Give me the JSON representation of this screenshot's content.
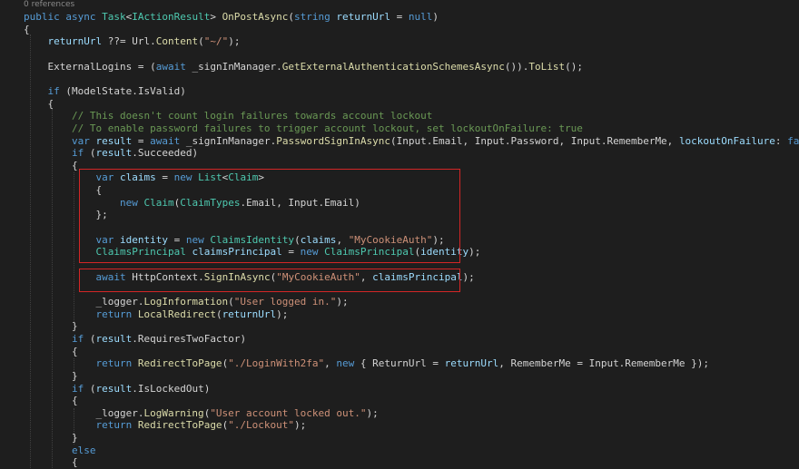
{
  "editor": {
    "codelens": "0 references",
    "colors": {
      "background": "#1e1e1e",
      "keyword": "#569cd6",
      "type": "#4ec9b0",
      "method": "#dcdcaa",
      "variable": "#9cdcfe",
      "string": "#ce9178",
      "comment": "#6a9955",
      "text": "#d4d4d4",
      "highlight_box": "#d32626"
    },
    "lines": [
      [
        [
          "public async ",
          "kw"
        ],
        [
          "Task",
          "ty"
        ],
        [
          "<",
          "pl"
        ],
        [
          "IActionResult",
          "ty"
        ],
        [
          "> ",
          "pl"
        ],
        [
          "OnPostAsync",
          "fn"
        ],
        [
          "(",
          "pl"
        ],
        [
          "string ",
          "kw"
        ],
        [
          "returnUrl",
          "va"
        ],
        [
          " = ",
          "pl"
        ],
        [
          "null",
          "kw"
        ],
        [
          ")",
          "pl"
        ]
      ],
      [
        [
          "{",
          "pl"
        ]
      ],
      [
        [
          "    ",
          "pl"
        ],
        [
          "returnUrl",
          "va"
        ],
        [
          " ??= Url.",
          "pl"
        ],
        [
          "Content",
          "fn"
        ],
        [
          "(",
          "pl"
        ],
        [
          "\"~/\"",
          "st"
        ],
        [
          ");",
          "pl"
        ]
      ],
      [
        [
          "",
          "pl"
        ]
      ],
      [
        [
          "    ExternalLogins = (",
          "pl"
        ],
        [
          "await ",
          "kw"
        ],
        [
          "_signInManager.",
          "pl"
        ],
        [
          "GetExternalAuthenticationSchemesAsync",
          "fn"
        ],
        [
          "()).",
          "pl"
        ],
        [
          "ToList",
          "fn"
        ],
        [
          "();",
          "pl"
        ]
      ],
      [
        [
          "",
          "pl"
        ]
      ],
      [
        [
          "    ",
          "pl"
        ],
        [
          "if ",
          "kw"
        ],
        [
          "(ModelState.IsValid)",
          "pl"
        ]
      ],
      [
        [
          "    {",
          "pl"
        ]
      ],
      [
        [
          "        // This doesn't count login failures towards account lockout",
          "cm"
        ]
      ],
      [
        [
          "        // To enable password failures to trigger account lockout, set lockoutOnFailure: true",
          "cm"
        ]
      ],
      [
        [
          "        ",
          "pl"
        ],
        [
          "var ",
          "kw"
        ],
        [
          "result",
          "va"
        ],
        [
          " = ",
          "pl"
        ],
        [
          "await ",
          "kw"
        ],
        [
          "_signInManager.",
          "pl"
        ],
        [
          "PasswordSignInAsync",
          "fn"
        ],
        [
          "(Input.Email, Input.Password, Input.RememberMe, ",
          "pl"
        ],
        [
          "lockoutOnFailure",
          "va"
        ],
        [
          ": ",
          "pl"
        ],
        [
          "false",
          "kw"
        ],
        [
          ");",
          "pl"
        ]
      ],
      [
        [
          "        ",
          "pl"
        ],
        [
          "if ",
          "kw"
        ],
        [
          "(",
          "pl"
        ],
        [
          "result",
          "va"
        ],
        [
          ".Succeeded)",
          "pl"
        ]
      ],
      [
        [
          "        {",
          "pl"
        ]
      ],
      [
        [
          "            ",
          "pl"
        ],
        [
          "var ",
          "kw"
        ],
        [
          "claims",
          "va"
        ],
        [
          " = ",
          "pl"
        ],
        [
          "new ",
          "kw"
        ],
        [
          "List",
          "ty"
        ],
        [
          "<",
          "pl"
        ],
        [
          "Claim",
          "ty"
        ],
        [
          ">",
          "pl"
        ]
      ],
      [
        [
          "            {",
          "pl"
        ]
      ],
      [
        [
          "                ",
          "pl"
        ],
        [
          "new ",
          "kw"
        ],
        [
          "Claim",
          "ty"
        ],
        [
          "(",
          "pl"
        ],
        [
          "ClaimTypes",
          "ty"
        ],
        [
          ".Email, Input.Email)",
          "pl"
        ]
      ],
      [
        [
          "            };",
          "pl"
        ]
      ],
      [
        [
          "",
          "pl"
        ]
      ],
      [
        [
          "            ",
          "pl"
        ],
        [
          "var ",
          "kw"
        ],
        [
          "identity",
          "va"
        ],
        [
          " = ",
          "pl"
        ],
        [
          "new ",
          "kw"
        ],
        [
          "ClaimsIdentity",
          "ty"
        ],
        [
          "(",
          "pl"
        ],
        [
          "claims",
          "va"
        ],
        [
          ", ",
          "pl"
        ],
        [
          "\"MyCookieAuth\"",
          "st"
        ],
        [
          ");",
          "pl"
        ]
      ],
      [
        [
          "            ",
          "pl"
        ],
        [
          "ClaimsPrincipal ",
          "ty"
        ],
        [
          "claimsPrincipal",
          "va"
        ],
        [
          " = ",
          "pl"
        ],
        [
          "new ",
          "kw"
        ],
        [
          "ClaimsPrincipal",
          "ty"
        ],
        [
          "(",
          "pl"
        ],
        [
          "identity",
          "va"
        ],
        [
          ");",
          "pl"
        ]
      ],
      [
        [
          "",
          "pl"
        ]
      ],
      [
        [
          "            ",
          "pl"
        ],
        [
          "await ",
          "kw"
        ],
        [
          "HttpContext.",
          "pl"
        ],
        [
          "SignInAsync",
          "fn"
        ],
        [
          "(",
          "pl"
        ],
        [
          "\"MyCookieAuth\"",
          "st"
        ],
        [
          ", ",
          "pl"
        ],
        [
          "claimsPrincipal",
          "va"
        ],
        [
          ");",
          "pl"
        ]
      ],
      [
        [
          "",
          "pl"
        ]
      ],
      [
        [
          "            _logger.",
          "pl"
        ],
        [
          "LogInformation",
          "fn"
        ],
        [
          "(",
          "pl"
        ],
        [
          "\"User logged in.\"",
          "st"
        ],
        [
          ");",
          "pl"
        ]
      ],
      [
        [
          "            ",
          "pl"
        ],
        [
          "return ",
          "kw"
        ],
        [
          "LocalRedirect",
          "fn"
        ],
        [
          "(",
          "pl"
        ],
        [
          "returnUrl",
          "va"
        ],
        [
          ");",
          "pl"
        ]
      ],
      [
        [
          "        }",
          "pl"
        ]
      ],
      [
        [
          "        ",
          "pl"
        ],
        [
          "if ",
          "kw"
        ],
        [
          "(",
          "pl"
        ],
        [
          "result",
          "va"
        ],
        [
          ".RequiresTwoFactor)",
          "pl"
        ]
      ],
      [
        [
          "        {",
          "pl"
        ]
      ],
      [
        [
          "            ",
          "pl"
        ],
        [
          "return ",
          "kw"
        ],
        [
          "RedirectToPage",
          "fn"
        ],
        [
          "(",
          "pl"
        ],
        [
          "\"./LoginWith2fa\"",
          "st"
        ],
        [
          ", ",
          "pl"
        ],
        [
          "new ",
          "kw"
        ],
        [
          "{ ReturnUrl = ",
          "pl"
        ],
        [
          "returnUrl",
          "va"
        ],
        [
          ", RememberMe = Input.RememberMe });",
          "pl"
        ]
      ],
      [
        [
          "        }",
          "pl"
        ]
      ],
      [
        [
          "        ",
          "pl"
        ],
        [
          "if ",
          "kw"
        ],
        [
          "(",
          "pl"
        ],
        [
          "result",
          "va"
        ],
        [
          ".IsLockedOut)",
          "pl"
        ]
      ],
      [
        [
          "        {",
          "pl"
        ]
      ],
      [
        [
          "            _logger.",
          "pl"
        ],
        [
          "LogWarning",
          "fn"
        ],
        [
          "(",
          "pl"
        ],
        [
          "\"User account locked out.\"",
          "st"
        ],
        [
          ");",
          "pl"
        ]
      ],
      [
        [
          "            ",
          "pl"
        ],
        [
          "return ",
          "kw"
        ],
        [
          "RedirectToPage",
          "fn"
        ],
        [
          "(",
          "pl"
        ],
        [
          "\"./Lockout\"",
          "st"
        ],
        [
          ");",
          "pl"
        ]
      ],
      [
        [
          "        }",
          "pl"
        ]
      ],
      [
        [
          "        ",
          "pl"
        ],
        [
          "else",
          "kw"
        ]
      ],
      [
        [
          "        {",
          "pl"
        ]
      ]
    ]
  }
}
